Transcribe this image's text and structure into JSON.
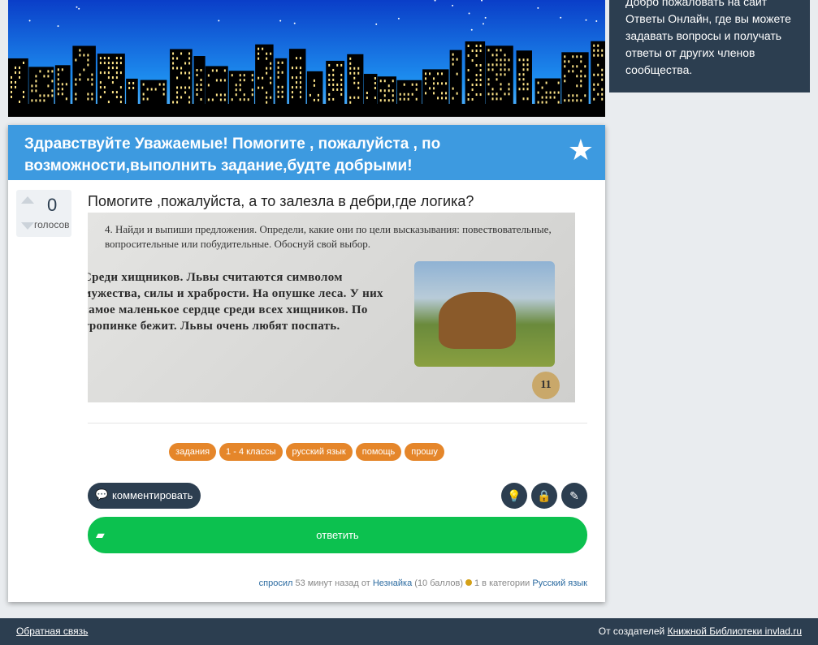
{
  "welcome": {
    "text": "Добро пожаловать на сайт Ответы Онлайн, где вы можете задавать вопросы и получать ответы от других членов сообщества."
  },
  "question": {
    "heading": "Здравствуйте Уважаемые! Помогите , пожалуйста , по возможности,выполнить задание,будте добрыми!",
    "votes": "0",
    "votes_label": "голосов",
    "title": "Помогите ,пожалуйста, а то залезла в дебри,где логика?",
    "image": {
      "task": "4. Найди и выпиши предложения. Определи, какие они по цели высказывания: повествовательные, вопросительные или побудительные. Обоснуй свой выбор.",
      "story": "Среди хищников. Львы считаются символом мужества, силы и храбрости. На опушке леса. У них самое маленькое сердце среди всех хищников. По тропинке бежит. Львы очень любят поспать.",
      "page": "11"
    },
    "tags": [
      "задания",
      "1 - 4 классы",
      "русский язык",
      "помощь",
      "прошу"
    ],
    "comment_label": "комментировать",
    "answer_label": "ответить",
    "meta": {
      "asked": "спросил",
      "time": "53 минут назад от",
      "user": "Незнайка",
      "points": "(10 баллов)",
      "count": "1 в категории",
      "category": "Русский язык"
    }
  },
  "footer": {
    "feedback": "Обратная связь",
    "credit_prefix": "От создателей",
    "credit_link": "Книжной Библиотеки invlad.ru"
  },
  "colors": {
    "header": "#3d9ae0",
    "dark": "#2c3e50",
    "tag": "#e5862a",
    "answer": "#0cc14f"
  }
}
